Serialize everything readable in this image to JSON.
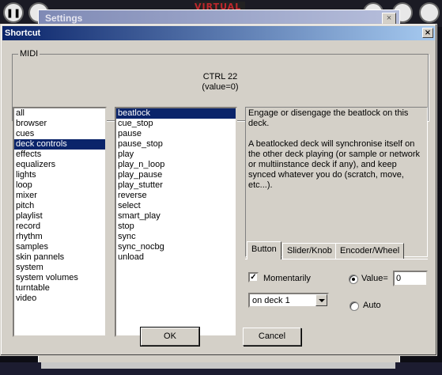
{
  "background": {
    "left_button_glyph": "❚❚",
    "brand_logo": "VIRTUAL DJ",
    "settings_window_title": "Settings",
    "settings_close_glyph": "×"
  },
  "dialog": {
    "title": "Shortcut",
    "close_glyph": "×"
  },
  "midi": {
    "legend": "MIDI",
    "key": "CTRL 22",
    "value": "(value=0)"
  },
  "categories": {
    "items": [
      "all",
      "browser",
      "cues",
      "deck controls",
      "effects",
      "equalizers",
      "lights",
      "loop",
      "mixer",
      "pitch",
      "playlist",
      "record",
      "rhythm",
      "samples",
      "skin pannels",
      "system",
      "system volumes",
      "turntable",
      "video"
    ],
    "selected": "deck controls"
  },
  "actions": {
    "items": [
      "beatlock",
      "cue_stop",
      "pause",
      "pause_stop",
      "play",
      "play_n_loop",
      "play_pause",
      "play_stutter",
      "reverse",
      "select",
      "smart_play",
      "stop",
      "sync",
      "sync_nocbg",
      "unload"
    ],
    "selected": "beatlock"
  },
  "description": {
    "line1": "Engage or disengage the beatlock on this deck.",
    "line2": "A beatlocked deck will synchronise itself on the other deck playing (or sample or network or multiinstance deck if any), and keep synced whatever you do (scratch, move, etc...)."
  },
  "tabs": [
    {
      "label": "Button",
      "active": true
    },
    {
      "label": "Slider/Knob",
      "active": false
    },
    {
      "label": "Encoder/Wheel",
      "active": false
    }
  ],
  "button_tab": {
    "momentarily_label": "Momentarily",
    "momentarily_checked": true,
    "deck_select": "on deck 1",
    "value_radio_label": "Value=",
    "value_field": "0",
    "auto_radio_label": "Auto",
    "selected_mode": "value"
  },
  "footer": {
    "ok_label": "OK",
    "cancel_label": "Cancel"
  }
}
